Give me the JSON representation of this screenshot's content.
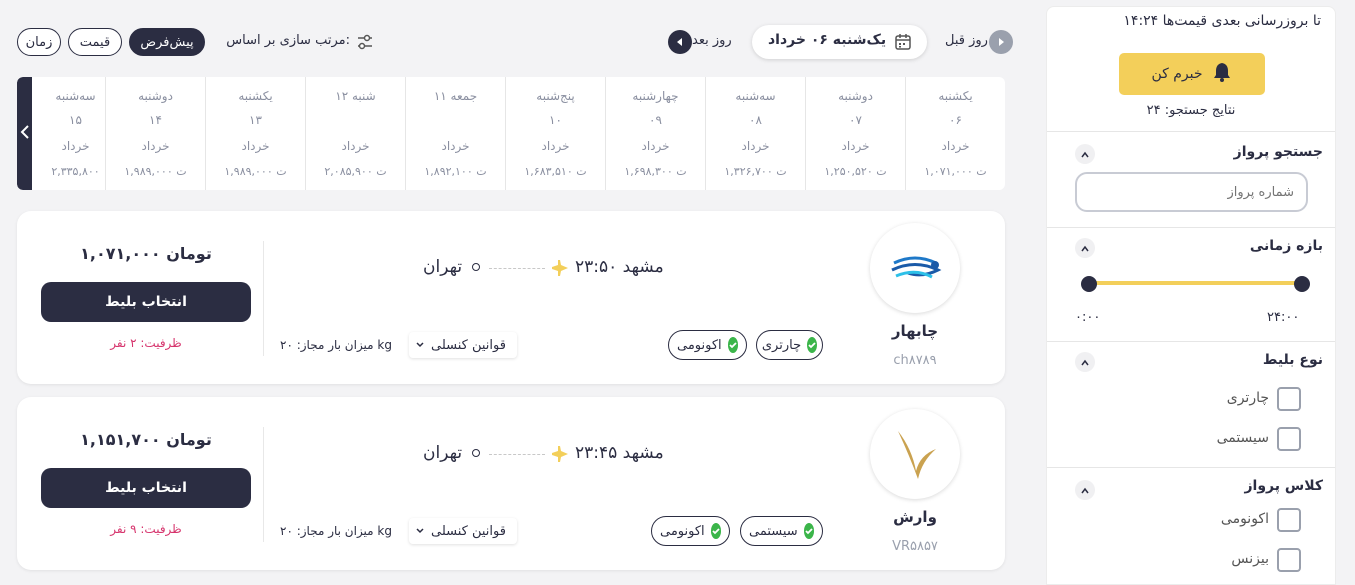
{
  "header": {
    "sort_label": "مرتب سازی بر اساس:",
    "sort_options": [
      "پیش‌فرض",
      "قیمت",
      "زمان"
    ],
    "prev_day": "روز قبل",
    "next_day": "روز بعد",
    "current_date": "یک‌شنبه ۰۶ خرداد"
  },
  "dates": [
    {
      "day": "یکشنبه",
      "num": "۰۶",
      "month": "خرداد",
      "price": "۱,۰۷۱,۰۰۰ ت"
    },
    {
      "day": "دوشنبه",
      "num": "۰۷",
      "month": "خرداد",
      "price": "۱,۲۵۰,۵۲۰ ت"
    },
    {
      "day": "سه‌شنبه",
      "num": "۰۸",
      "month": "خرداد",
      "price": "۱,۳۲۶,۷۰۰ ت"
    },
    {
      "day": "چهارشنبه",
      "num": "۰۹",
      "month": "خرداد",
      "price": "۱,۶۹۸,۳۰۰ ت"
    },
    {
      "day": "پنج‌شنبه",
      "num": "۱۰",
      "month": "خرداد",
      "price": "۱,۶۸۳,۵۱۰ ت"
    },
    {
      "day": "جمعه ۱۱",
      "num": "",
      "month": "خرداد",
      "price": "۱,۸۹۲,۱۰۰ ت"
    },
    {
      "day": "شنبه ۱۲",
      "num": "",
      "month": "خرداد",
      "price": "۲,۰۸۵,۹۰۰ ت"
    },
    {
      "day": "یکشنبه",
      "num": "۱۳",
      "month": "خرداد",
      "price": "۱,۹۸۹,۰۰۰ ت"
    },
    {
      "day": "دوشنبه",
      "num": "۱۴",
      "month": "خرداد",
      "price": "۱,۹۸۹,۰۰۰ ت"
    },
    {
      "day": "سه‌شنبه",
      "num": "۱۵",
      "month": "خرداد",
      "price": "۲,۳۳۵,۸۰۰"
    }
  ],
  "flights": [
    {
      "airline": "چابهار",
      "code": "ch۸۷۸۹",
      "origin": "مشهد",
      "time": "۲۳:۵۰",
      "destination": "تهران",
      "tags": [
        "چارتری",
        "اکونومی"
      ],
      "rules": "قوانین کنسلی",
      "baggage": "میزان بار مجاز: ۲۰ kg",
      "price": "۱,۰۷۱,۰۰۰ تومان",
      "button": "انتخاب بلیط",
      "capacity": "ظرفیت: ۲ نفر"
    },
    {
      "airline": "وارش",
      "code": "VR۵۸۵۷",
      "origin": "مشهد",
      "time": "۲۳:۴۵",
      "destination": "تهران",
      "tags": [
        "سیستمی",
        "اکونومی"
      ],
      "rules": "قوانین کنسلی",
      "baggage": "میزان بار مجاز: ۲۰ kg",
      "price": "۱,۱۵۱,۷۰۰ تومان",
      "button": "انتخاب بلیط",
      "capacity": "ظرفیت: ۹ نفر"
    }
  ],
  "sidebar": {
    "update_text": "تا بروزرسانی بعدی قیمت‌ها ۱۴:۲۴",
    "notify_button": "خبرم کن",
    "results_count": "نتایج جستجو: ۲۴",
    "search_title": "جستجو پرواز",
    "search_placeholder": "شماره پرواز",
    "time_title": "بازه زمانی",
    "time_min": "۰:۰۰",
    "time_max": "۲۴:۰۰",
    "ticket_type_title": "نوع بلیط",
    "ticket_types": [
      "چارتری",
      "سیستمی"
    ],
    "class_title": "کلاس پرواز",
    "classes": [
      "اکونومی",
      "بیزنس"
    ]
  },
  "colors": {
    "primary": "#2b2d42",
    "accent": "#f3cf5a",
    "success": "#3bb54a",
    "danger": "#d6336c"
  }
}
